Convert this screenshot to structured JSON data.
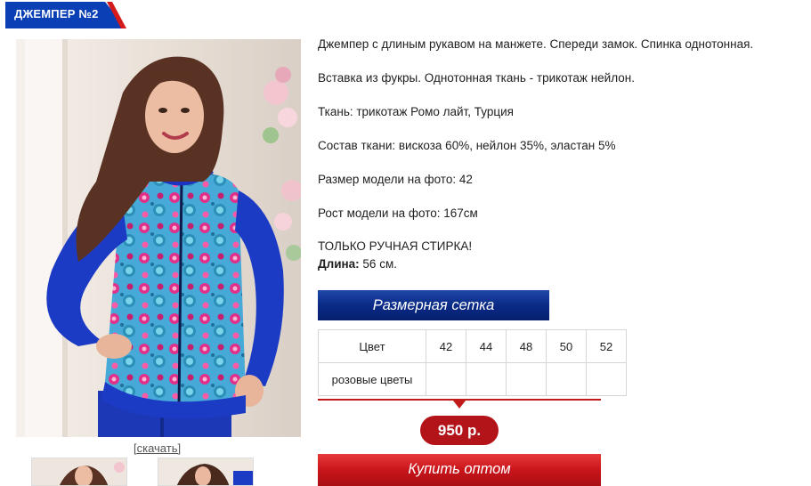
{
  "product": {
    "title": "ДЖЕМПЕР №2",
    "download_label": "[скачать]",
    "description": [
      "Джемпер с длиным рукавом на манжете. Спереди замок. Спинка однотонная.",
      "Вставка из фукры. Однотонная ткань - трикотаж нейлон.",
      "Ткань: трикотаж Ромо лайт, Турция",
      "Состав ткани: вискоза 60%, нейлон 35%, эластан 5%",
      "Размер модели на фото: 42",
      "Рост модели на фото: 167см",
      "ТОЛЬКО РУЧНАЯ СТИРКА!"
    ],
    "length_label": "Длина:",
    "length_value": "56 см.",
    "size_grid_button": "Размерная сетка",
    "table": {
      "header": [
        "Цвет",
        "42",
        "44",
        "48",
        "50",
        "52"
      ],
      "rows": [
        [
          "розовые цветы",
          "",
          "",
          "",
          "",
          ""
        ]
      ]
    },
    "price": "950 р.",
    "buy_button": "Купить оптом"
  },
  "colors": {
    "brand_blue": "#0a3fb5",
    "accent_red": "#c21a1a",
    "jacket_blue": "#1c3bc4",
    "print_pink": "#e0308a",
    "print_cyan": "#3fb2dc"
  }
}
